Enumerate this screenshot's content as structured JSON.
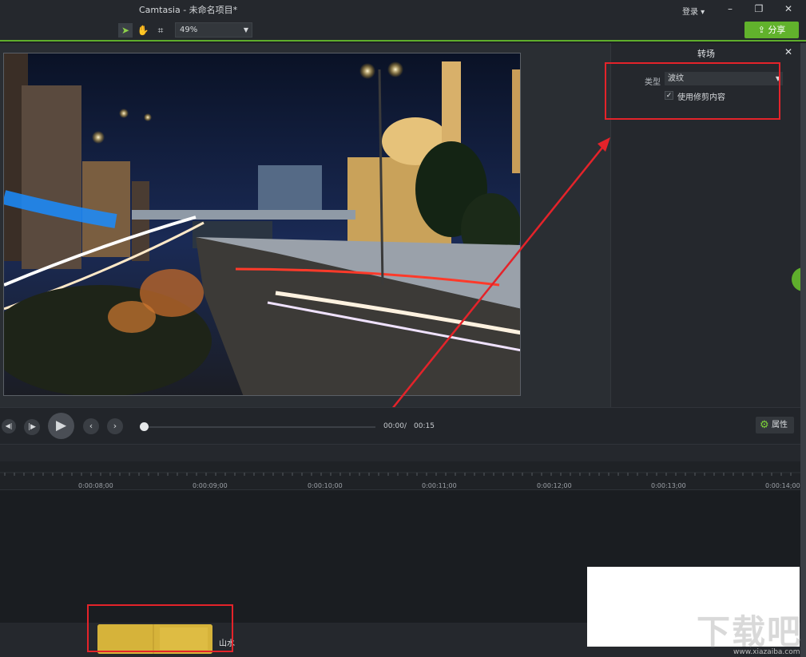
{
  "titlebar": {
    "title": "Camtasia - 未命名项目*",
    "login": "登录 ▾",
    "minimize": "–",
    "restore": "❐",
    "close": "✕"
  },
  "toolbar": {
    "zoom": "49%",
    "share": "分享"
  },
  "panel": {
    "title": "转场",
    "type_label": "类型",
    "type_value": "波纹",
    "use_trim_label": "使用修剪内容",
    "use_trim_checked": true
  },
  "playback": {
    "current_time": "00:00",
    "separator": "/",
    "total_time": "00:15",
    "properties": "属性"
  },
  "timeline": {
    "ticks": [
      "0:00:08;00",
      "0:00:09;00",
      "0:00:10;00",
      "0:00:11;00",
      "0:00:12;00",
      "0:00:13;00",
      "0:00:14;00"
    ],
    "clip_label": "山水"
  },
  "watermark": {
    "text": "下载吧",
    "url": "www.xiazaiba.com"
  },
  "colors": {
    "accent": "#5fae2c",
    "highlight": "#e4232a",
    "clip": "#d6b33a"
  }
}
